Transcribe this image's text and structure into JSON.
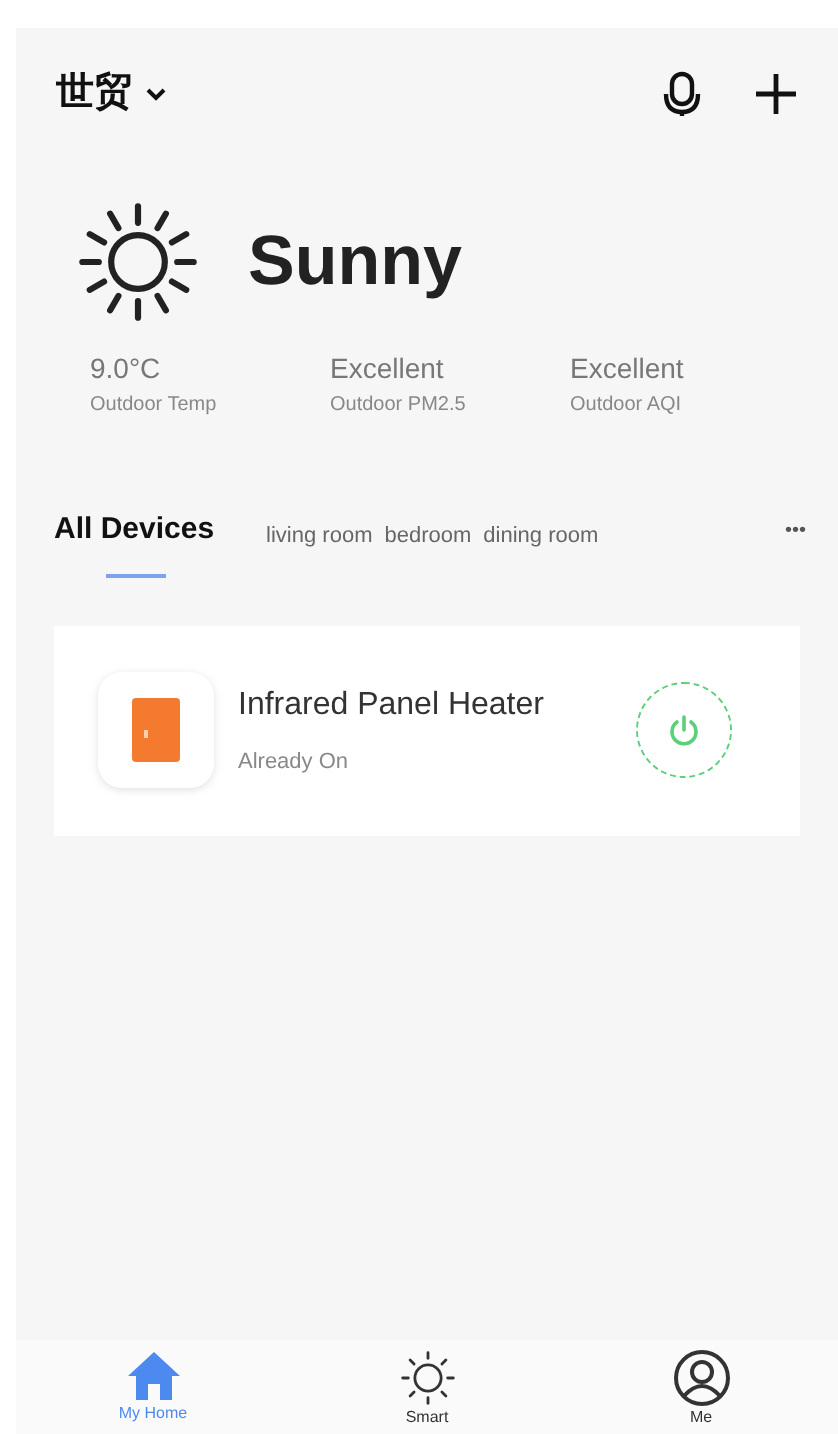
{
  "header": {
    "home": "世贸"
  },
  "weather": {
    "condition": "Sunny",
    "stats": [
      {
        "value": "9.0°C",
        "label": "Outdoor Temp"
      },
      {
        "value": "Excellent",
        "label": "Outdoor PM2.5"
      },
      {
        "value": "Excellent",
        "label": "Outdoor AQI"
      }
    ]
  },
  "tabs": [
    {
      "label": "All Devices",
      "selected": true
    },
    {
      "label": "living room",
      "selected": false
    },
    {
      "label": "bedroom",
      "selected": false
    },
    {
      "label": "dining room",
      "selected": false
    }
  ],
  "more": "•••",
  "devices": [
    {
      "name": "Infrared Panel Heater",
      "status": "Already On",
      "on": true
    }
  ],
  "nav": [
    {
      "label": "My Home",
      "kind": "home",
      "selected": true
    },
    {
      "label": "Smart",
      "kind": "smart",
      "selected": false
    },
    {
      "label": "Me",
      "kind": "me",
      "selected": false
    }
  ]
}
